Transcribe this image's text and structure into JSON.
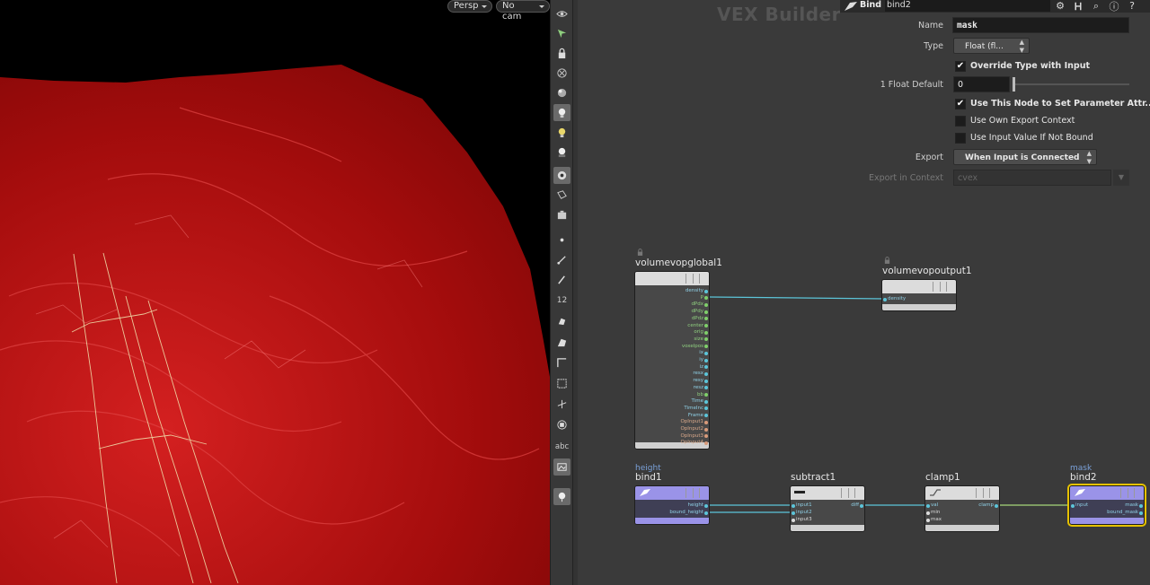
{
  "viewport": {
    "view_menu": "Persp",
    "camera_menu": "No cam"
  },
  "toolbar": {
    "icons": [
      "eye-icon",
      "select-visible-icon",
      "lock-icon",
      "ghost-icon",
      "shade-icon",
      "headlight-icon",
      "bulb-icon",
      "bulb-shadow-icon",
      "camera-icon",
      "render-icon",
      "snapshot-icon",
      "point-icon",
      "vector-icon",
      "pen-icon",
      "number-icon",
      "guide-icon",
      "brush-icon",
      "frame-icon",
      "grid-icon",
      "axis-icon",
      "stop-icon",
      "text-icon",
      "image-icon",
      "pin-icon"
    ],
    "number_label": "12",
    "text_label": "abc"
  },
  "network": {
    "context_title": "VEX Builder",
    "nodes": {
      "global": {
        "title": "volumevopglobal1",
        "ports": [
          "density",
          "P",
          "dPdx",
          "dPdy",
          "dPdz",
          "center",
          "orig",
          "size",
          "voxelpos",
          "ix",
          "iy",
          "iz",
          "resx",
          "resy",
          "resz",
          "bb",
          "Time",
          "TimeInc",
          "Frame",
          "OpInput1",
          "OpInput2",
          "OpInput3",
          "OpInput4"
        ]
      },
      "output": {
        "title": "volumevopoutput1",
        "ports": [
          "density"
        ]
      },
      "bind1": {
        "sub": "height",
        "title": "bind1",
        "ports": [
          "height",
          "bound_height"
        ]
      },
      "subtract": {
        "title": "subtract1",
        "inputs": [
          "input1",
          "input2",
          "input3"
        ],
        "outputs": [
          "diff"
        ]
      },
      "clamp": {
        "title": "clamp1",
        "inputs": [
          "val",
          "min",
          "max"
        ],
        "outputs": [
          "clamp"
        ]
      },
      "bind2": {
        "sub": "mask",
        "title": "bind2",
        "inputs": [
          "input"
        ],
        "outputs": [
          "mask",
          "bound_mask"
        ]
      }
    }
  },
  "params": {
    "node_type": "Bind",
    "node_name": "bind2",
    "name_label": "Name",
    "name_value": "mask",
    "type_label": "Type",
    "type_value": "Float (fl...",
    "override_label": "Override Type with Input",
    "override_checked": true,
    "float_default_label": "1 Float Default",
    "float_default_value": "0",
    "use_node_label": "Use This Node to Set Parameter Attr...",
    "use_node_checked": true,
    "own_export_label": "Use Own Export Context",
    "input_value_label": "Use Input Value If Not Bound",
    "export_label": "Export",
    "export_value": "When Input is Connected",
    "export_context_label": "Export in Context",
    "export_context_value": "cvex"
  },
  "colors": {
    "terrain": "#b30f0f",
    "node_purple": "#9a93e8",
    "selection": "#e5c100",
    "wire": "#5cc5d9"
  }
}
